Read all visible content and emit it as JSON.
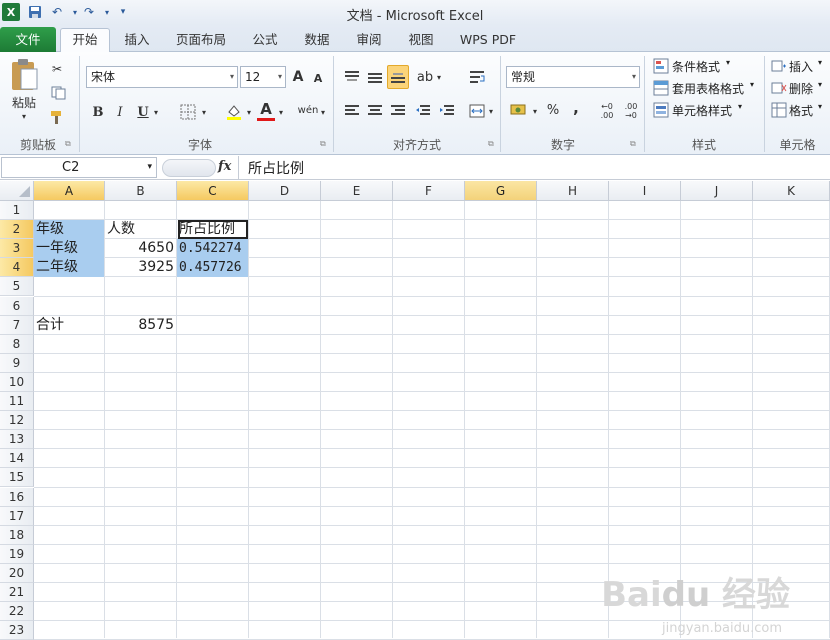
{
  "window": {
    "title": "文档 - Microsoft Excel"
  },
  "quick_access": {
    "app_icon": "excel-icon",
    "save_icon": "save-icon",
    "undo_icon": "undo-icon",
    "redo_icon": "redo-icon",
    "customize_icon": "customize-icon"
  },
  "tabs": [
    {
      "label": "文件"
    },
    {
      "label": "开始"
    },
    {
      "label": "插入"
    },
    {
      "label": "页面布局"
    },
    {
      "label": "公式"
    },
    {
      "label": "数据"
    },
    {
      "label": "审阅"
    },
    {
      "label": "视图"
    },
    {
      "label": "WPS PDF"
    }
  ],
  "ribbon": {
    "clipboard": {
      "paste_label": "粘贴",
      "group_label": "剪贴板"
    },
    "font": {
      "font_name": "宋体",
      "font_size": "12",
      "group_label": "字体",
      "bold": "B",
      "italic": "I",
      "underline": "U",
      "grow": "A",
      "shrink": "A",
      "phonetic": "wén"
    },
    "alignment": {
      "group_label": "对齐方式"
    },
    "number": {
      "format": "常规",
      "percent": "%",
      "comma": ",",
      "group_label": "数字"
    },
    "styles": {
      "conditional": "条件格式",
      "table": "套用表格格式",
      "cell_styles": "单元格样式",
      "group_label": "样式"
    },
    "cells": {
      "insert": "插入",
      "delete": "删除",
      "format": "格式",
      "group_label": "单元格"
    }
  },
  "formula_bar": {
    "name_box": "C2",
    "fx": "fx",
    "content": "所占比例"
  },
  "columns": [
    "A",
    "B",
    "C",
    "D",
    "E",
    "F",
    "G",
    "H",
    "I",
    "J",
    "K"
  ],
  "rows": [
    "1",
    "2",
    "3",
    "4",
    "5",
    "6",
    "7",
    "8",
    "9",
    "10",
    "11",
    "12",
    "13",
    "14",
    "15",
    "16",
    "17",
    "18",
    "19",
    "20",
    "21",
    "22",
    "23"
  ],
  "cells": {
    "A2": "年级",
    "B2": "人数",
    "C2": "所占比例",
    "A3": "一年级",
    "B3": "4650",
    "C3": "0.542274",
    "A4": "二年级",
    "B4": "3925",
    "C4": "0.457726",
    "A7": "合计",
    "B7": "8575"
  },
  "watermark": {
    "logo": "Bai du 经验",
    "url": "jingyan.baidu.com"
  }
}
